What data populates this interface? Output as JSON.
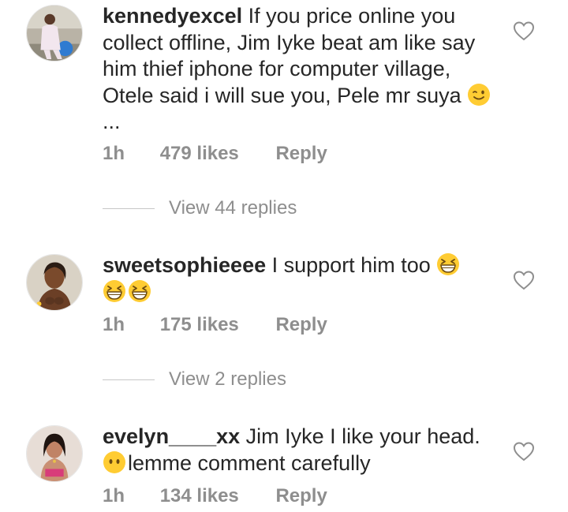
{
  "comments": [
    {
      "username": "kennedyexcel",
      "text": "If you price online you collect offline, Jim Iyke beat am like say him thief iphone for computer village, Otele said i will sue you, Pele mr suya",
      "trailing_text": "...",
      "emoji_icons": [
        "winking-face-icon"
      ],
      "time": "1h",
      "likes": "479 likes",
      "reply": "Reply",
      "view_replies": "View 44 replies"
    },
    {
      "username": "sweetsophieeee",
      "text": "I support him too",
      "emoji_icons": [
        "grinning-squinting-face-icon",
        "grinning-squinting-face-icon",
        "grinning-squinting-face-icon"
      ],
      "time": "1h",
      "likes": "175 likes",
      "reply": "Reply",
      "view_replies": "View 2 replies"
    },
    {
      "username": "evelyn____xx",
      "text": "Jim Iyke I like your head.",
      "text2": "lemme comment carefully",
      "emoji_icons": [
        "face-without-mouth-icon"
      ],
      "time": "1h",
      "likes": "134 likes",
      "reply": "Reply"
    }
  ],
  "colors": {
    "text_primary": "#262626",
    "text_secondary": "#8e8e8e",
    "divider": "#c7c7c7",
    "emoji_yellow": "#ffcc33"
  }
}
